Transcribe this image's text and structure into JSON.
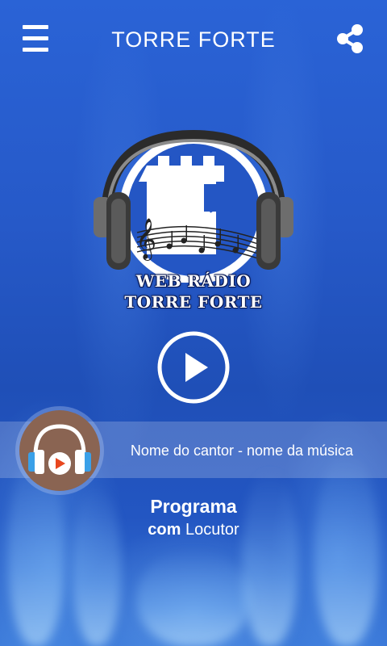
{
  "header": {
    "title": "TORRE FORTE",
    "menu_icon": "hamburger-menu-icon",
    "share_icon": "share-icon"
  },
  "logo": {
    "line1": "WEB RÁDIO",
    "line2": "TORRE FORTE",
    "icon": "headphones-tower-logo"
  },
  "player": {
    "play_icon": "play-icon",
    "now_playing_icon": "headphones-play-icon",
    "now_playing": "Nome do cantor - nome da música"
  },
  "program": {
    "title": "Programa",
    "with_label": "com",
    "host": "Locutor"
  },
  "colors": {
    "background": "#2659c8",
    "accent_circle": "#8a6452",
    "text": "#ffffff"
  }
}
